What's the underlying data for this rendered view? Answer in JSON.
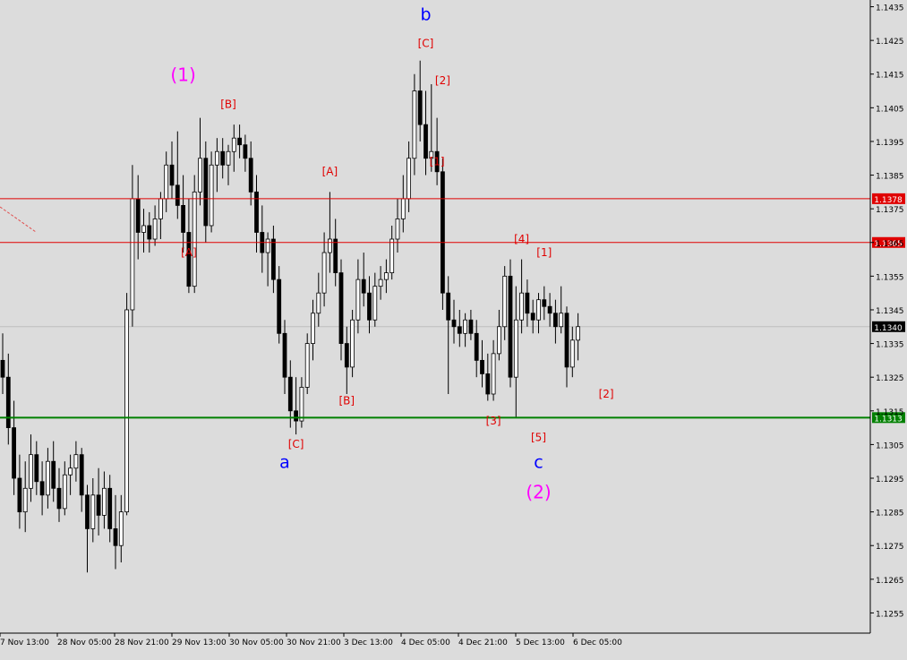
{
  "chart_data": {
    "type": "candlestick",
    "title": "",
    "y_range": [
      1.1249,
      1.1437
    ],
    "y_ticks": [
      "1.1435",
      "1.1425",
      "1.1415",
      "1.1405",
      "1.1395",
      "1.1385",
      "1.1375",
      "1.1365",
      "1.1355",
      "1.1345",
      "1.1335",
      "1.1325",
      "1.1315",
      "1.1305",
      "1.1295",
      "1.1285",
      "1.1275",
      "1.1265",
      "1.1255"
    ],
    "x_ticks": [
      "7 Nov 13:00",
      "28 Nov 05:00",
      "28 Nov 21:00",
      "29 Nov 13:00",
      "30 Nov 05:00",
      "30 Nov 21:00",
      "3 Dec 13:00",
      "4 Dec 05:00",
      "4 Dec 21:00",
      "5 Dec 13:00",
      "6 Dec 05:00"
    ],
    "current_price": "1.1340",
    "price_lines": [
      {
        "label": "1.1378",
        "value": 1.1378,
        "color": "#e00000"
      },
      {
        "label": "1.1365",
        "value": 1.1365,
        "color": "#e00000"
      },
      {
        "label": "1.1313",
        "value": 1.1313,
        "color": "#008000"
      }
    ],
    "candles": [
      {
        "o": 1.133,
        "h": 1.1338,
        "l": 1.132,
        "c": 1.1325
      },
      {
        "o": 1.1325,
        "h": 1.1332,
        "l": 1.1305,
        "c": 1.131
      },
      {
        "o": 1.131,
        "h": 1.1318,
        "l": 1.129,
        "c": 1.1295
      },
      {
        "o": 1.1295,
        "h": 1.1302,
        "l": 1.128,
        "c": 1.1285
      },
      {
        "o": 1.1285,
        "h": 1.13,
        "l": 1.1279,
        "c": 1.1292
      },
      {
        "o": 1.1292,
        "h": 1.1308,
        "l": 1.1288,
        "c": 1.1302
      },
      {
        "o": 1.1302,
        "h": 1.1306,
        "l": 1.129,
        "c": 1.1294
      },
      {
        "o": 1.1294,
        "h": 1.13,
        "l": 1.1284,
        "c": 1.129
      },
      {
        "o": 1.129,
        "h": 1.1304,
        "l": 1.1286,
        "c": 1.13
      },
      {
        "o": 1.13,
        "h": 1.1306,
        "l": 1.1288,
        "c": 1.1292
      },
      {
        "o": 1.1292,
        "h": 1.1298,
        "l": 1.1282,
        "c": 1.1286
      },
      {
        "o": 1.1286,
        "h": 1.13,
        "l": 1.1284,
        "c": 1.1296
      },
      {
        "o": 1.1296,
        "h": 1.1302,
        "l": 1.129,
        "c": 1.1298
      },
      {
        "o": 1.1298,
        "h": 1.1306,
        "l": 1.1294,
        "c": 1.1302
      },
      {
        "o": 1.1302,
        "h": 1.1304,
        "l": 1.1285,
        "c": 1.129
      },
      {
        "o": 1.129,
        "h": 1.1293,
        "l": 1.1267,
        "c": 1.128
      },
      {
        "o": 1.128,
        "h": 1.1295,
        "l": 1.1276,
        "c": 1.129
      },
      {
        "o": 1.129,
        "h": 1.1298,
        "l": 1.1278,
        "c": 1.1284
      },
      {
        "o": 1.1284,
        "h": 1.1297,
        "l": 1.128,
        "c": 1.1292
      },
      {
        "o": 1.1292,
        "h": 1.1296,
        "l": 1.1276,
        "c": 1.128
      },
      {
        "o": 1.128,
        "h": 1.129,
        "l": 1.1268,
        "c": 1.1275
      },
      {
        "o": 1.1275,
        "h": 1.129,
        "l": 1.127,
        "c": 1.1285
      },
      {
        "o": 1.1285,
        "h": 1.135,
        "l": 1.1284,
        "c": 1.1345
      },
      {
        "o": 1.1345,
        "h": 1.1388,
        "l": 1.134,
        "c": 1.1378
      },
      {
        "o": 1.1378,
        "h": 1.1385,
        "l": 1.136,
        "c": 1.1368
      },
      {
        "o": 1.1368,
        "h": 1.1375,
        "l": 1.1362,
        "c": 1.137
      },
      {
        "o": 1.137,
        "h": 1.1374,
        "l": 1.1362,
        "c": 1.1366
      },
      {
        "o": 1.1366,
        "h": 1.1376,
        "l": 1.1364,
        "c": 1.1372
      },
      {
        "o": 1.1372,
        "h": 1.138,
        "l": 1.1366,
        "c": 1.1378
      },
      {
        "o": 1.1378,
        "h": 1.1392,
        "l": 1.1374,
        "c": 1.1388
      },
      {
        "o": 1.1388,
        "h": 1.1395,
        "l": 1.1378,
        "c": 1.1382
      },
      {
        "o": 1.1382,
        "h": 1.1398,
        "l": 1.1372,
        "c": 1.1376
      },
      {
        "o": 1.1376,
        "h": 1.1385,
        "l": 1.1362,
        "c": 1.1368
      },
      {
        "o": 1.1368,
        "h": 1.1378,
        "l": 1.135,
        "c": 1.1352
      },
      {
        "o": 1.1352,
        "h": 1.1385,
        "l": 1.135,
        "c": 1.138
      },
      {
        "o": 1.138,
        "h": 1.1402,
        "l": 1.1376,
        "c": 1.139
      },
      {
        "o": 1.139,
        "h": 1.1395,
        "l": 1.1365,
        "c": 1.137
      },
      {
        "o": 1.137,
        "h": 1.1392,
        "l": 1.1368,
        "c": 1.1388
      },
      {
        "o": 1.1388,
        "h": 1.1396,
        "l": 1.138,
        "c": 1.1392
      },
      {
        "o": 1.1392,
        "h": 1.1396,
        "l": 1.1384,
        "c": 1.1388
      },
      {
        "o": 1.1388,
        "h": 1.1394,
        "l": 1.1382,
        "c": 1.1392
      },
      {
        "o": 1.1392,
        "h": 1.14,
        "l": 1.1386,
        "c": 1.1396
      },
      {
        "o": 1.1396,
        "h": 1.14,
        "l": 1.139,
        "c": 1.1394
      },
      {
        "o": 1.1394,
        "h": 1.1397,
        "l": 1.1386,
        "c": 1.139
      },
      {
        "o": 1.139,
        "h": 1.1395,
        "l": 1.1376,
        "c": 1.138
      },
      {
        "o": 1.138,
        "h": 1.1385,
        "l": 1.1362,
        "c": 1.1368
      },
      {
        "o": 1.1368,
        "h": 1.1376,
        "l": 1.1356,
        "c": 1.1362
      },
      {
        "o": 1.1362,
        "h": 1.1368,
        "l": 1.1352,
        "c": 1.1366
      },
      {
        "o": 1.1366,
        "h": 1.137,
        "l": 1.135,
        "c": 1.1354
      },
      {
        "o": 1.1354,
        "h": 1.1358,
        "l": 1.1335,
        "c": 1.1338
      },
      {
        "o": 1.1338,
        "h": 1.1342,
        "l": 1.132,
        "c": 1.1325
      },
      {
        "o": 1.1325,
        "h": 1.133,
        "l": 1.131,
        "c": 1.1315
      },
      {
        "o": 1.1315,
        "h": 1.1325,
        "l": 1.1308,
        "c": 1.1312
      },
      {
        "o": 1.1312,
        "h": 1.1325,
        "l": 1.131,
        "c": 1.1322
      },
      {
        "o": 1.1322,
        "h": 1.1338,
        "l": 1.132,
        "c": 1.1335
      },
      {
        "o": 1.1335,
        "h": 1.1348,
        "l": 1.133,
        "c": 1.1344
      },
      {
        "o": 1.1344,
        "h": 1.1356,
        "l": 1.134,
        "c": 1.135
      },
      {
        "o": 1.135,
        "h": 1.1368,
        "l": 1.1346,
        "c": 1.1362
      },
      {
        "o": 1.1362,
        "h": 1.138,
        "l": 1.1356,
        "c": 1.1366
      },
      {
        "o": 1.1366,
        "h": 1.1372,
        "l": 1.1352,
        "c": 1.1356
      },
      {
        "o": 1.1356,
        "h": 1.136,
        "l": 1.133,
        "c": 1.1335
      },
      {
        "o": 1.1335,
        "h": 1.134,
        "l": 1.132,
        "c": 1.1328
      },
      {
        "o": 1.1328,
        "h": 1.1345,
        "l": 1.1325,
        "c": 1.1342
      },
      {
        "o": 1.1342,
        "h": 1.136,
        "l": 1.1338,
        "c": 1.1354
      },
      {
        "o": 1.1354,
        "h": 1.1362,
        "l": 1.1346,
        "c": 1.135
      },
      {
        "o": 1.135,
        "h": 1.1355,
        "l": 1.1338,
        "c": 1.1342
      },
      {
        "o": 1.1342,
        "h": 1.1356,
        "l": 1.134,
        "c": 1.1352
      },
      {
        "o": 1.1352,
        "h": 1.1358,
        "l": 1.1348,
        "c": 1.1354
      },
      {
        "o": 1.1354,
        "h": 1.136,
        "l": 1.135,
        "c": 1.1356
      },
      {
        "o": 1.1356,
        "h": 1.137,
        "l": 1.1354,
        "c": 1.1366
      },
      {
        "o": 1.1366,
        "h": 1.1378,
        "l": 1.1362,
        "c": 1.1372
      },
      {
        "o": 1.1372,
        "h": 1.1385,
        "l": 1.1368,
        "c": 1.1378
      },
      {
        "o": 1.1378,
        "h": 1.1395,
        "l": 1.1374,
        "c": 1.139
      },
      {
        "o": 1.139,
        "h": 1.1415,
        "l": 1.1385,
        "c": 1.141
      },
      {
        "o": 1.141,
        "h": 1.1419,
        "l": 1.1395,
        "c": 1.14
      },
      {
        "o": 1.14,
        "h": 1.141,
        "l": 1.1385,
        "c": 1.139
      },
      {
        "o": 1.139,
        "h": 1.1412,
        "l": 1.1386,
        "c": 1.1392
      },
      {
        "o": 1.1392,
        "h": 1.1402,
        "l": 1.1382,
        "c": 1.1386
      },
      {
        "o": 1.1386,
        "h": 1.139,
        "l": 1.1345,
        "c": 1.135
      },
      {
        "o": 1.135,
        "h": 1.1355,
        "l": 1.132,
        "c": 1.1342
      },
      {
        "o": 1.1342,
        "h": 1.1348,
        "l": 1.1335,
        "c": 1.134
      },
      {
        "o": 1.134,
        "h": 1.1345,
        "l": 1.1334,
        "c": 1.1338
      },
      {
        "o": 1.1338,
        "h": 1.1344,
        "l": 1.1334,
        "c": 1.1342
      },
      {
        "o": 1.1342,
        "h": 1.1345,
        "l": 1.1336,
        "c": 1.1338
      },
      {
        "o": 1.1338,
        "h": 1.1342,
        "l": 1.1325,
        "c": 1.133
      },
      {
        "o": 1.133,
        "h": 1.1336,
        "l": 1.1322,
        "c": 1.1326
      },
      {
        "o": 1.1326,
        "h": 1.1332,
        "l": 1.1318,
        "c": 1.132
      },
      {
        "o": 1.132,
        "h": 1.1336,
        "l": 1.1318,
        "c": 1.1332
      },
      {
        "o": 1.1332,
        "h": 1.1345,
        "l": 1.133,
        "c": 1.134
      },
      {
        "o": 1.134,
        "h": 1.1358,
        "l": 1.1336,
        "c": 1.1355
      },
      {
        "o": 1.1355,
        "h": 1.136,
        "l": 1.1322,
        "c": 1.1325
      },
      {
        "o": 1.1325,
        "h": 1.1352,
        "l": 1.1313,
        "c": 1.1342
      },
      {
        "o": 1.1342,
        "h": 1.136,
        "l": 1.1338,
        "c": 1.135
      },
      {
        "o": 1.135,
        "h": 1.1354,
        "l": 1.134,
        "c": 1.1344
      },
      {
        "o": 1.1344,
        "h": 1.1348,
        "l": 1.1338,
        "c": 1.1342
      },
      {
        "o": 1.1342,
        "h": 1.135,
        "l": 1.1338,
        "c": 1.1348
      },
      {
        "o": 1.1348,
        "h": 1.1352,
        "l": 1.1342,
        "c": 1.1346
      },
      {
        "o": 1.1346,
        "h": 1.135,
        "l": 1.134,
        "c": 1.1344
      },
      {
        "o": 1.1344,
        "h": 1.1348,
        "l": 1.1335,
        "c": 1.134
      },
      {
        "o": 1.134,
        "h": 1.1352,
        "l": 1.1338,
        "c": 1.1344
      },
      {
        "o": 1.1344,
        "h": 1.1346,
        "l": 1.1322,
        "c": 1.1328
      },
      {
        "o": 1.1328,
        "h": 1.134,
        "l": 1.1325,
        "c": 1.1336
      },
      {
        "o": 1.1336,
        "h": 1.1344,
        "l": 1.133,
        "c": 1.134
      }
    ],
    "annotations": [
      {
        "text": "(1)",
        "color": "#ff00ff",
        "size": 20,
        "i": 32,
        "y": 1.1413
      },
      {
        "text": "b",
        "color": "#0000ff",
        "size": 19,
        "i": 75,
        "y": 1.1431
      },
      {
        "text": "[C]",
        "color": "#e00000",
        "size": 12,
        "i": 75,
        "y": 1.1423
      },
      {
        "text": "[2]",
        "color": "#e00000",
        "size": 12,
        "i": 78,
        "y": 1.1412
      },
      {
        "text": "[1]",
        "color": "#e00000",
        "size": 12,
        "i": 77,
        "y": 1.1388
      },
      {
        "text": "[B]",
        "color": "#e00000",
        "size": 12,
        "i": 40,
        "y": 1.1405
      },
      {
        "text": "[A]",
        "color": "#e00000",
        "size": 12,
        "i": 33,
        "y": 1.1361
      },
      {
        "text": "[A]",
        "color": "#e00000",
        "size": 12,
        "i": 58,
        "y": 1.1385
      },
      {
        "text": "[B]",
        "color": "#e00000",
        "size": 12,
        "i": 61,
        "y": 1.1317
      },
      {
        "text": "[C]",
        "color": "#e00000",
        "size": 12,
        "i": 52,
        "y": 1.1304
      },
      {
        "text": "a",
        "color": "#0000ff",
        "size": 19,
        "i": 50,
        "y": 1.1298
      },
      {
        "text": "[4]",
        "color": "#e00000",
        "size": 12,
        "i": 92,
        "y": 1.1365
      },
      {
        "text": "[1]",
        "color": "#e00000",
        "size": 12,
        "i": 96,
        "y": 1.1361
      },
      {
        "text": "[3]",
        "color": "#e00000",
        "size": 12,
        "i": 87,
        "y": 1.1311
      },
      {
        "text": "[5]",
        "color": "#e00000",
        "size": 12,
        "i": 95,
        "y": 1.1306
      },
      {
        "text": "c",
        "color": "#0000ff",
        "size": 19,
        "i": 95,
        "y": 1.1298
      },
      {
        "text": "(2)",
        "color": "#ff00ff",
        "size": 20,
        "i": 95,
        "y": 1.1289
      },
      {
        "text": "[2]",
        "color": "#e00000",
        "size": 12,
        "i": 107,
        "y": 1.1319
      }
    ]
  }
}
